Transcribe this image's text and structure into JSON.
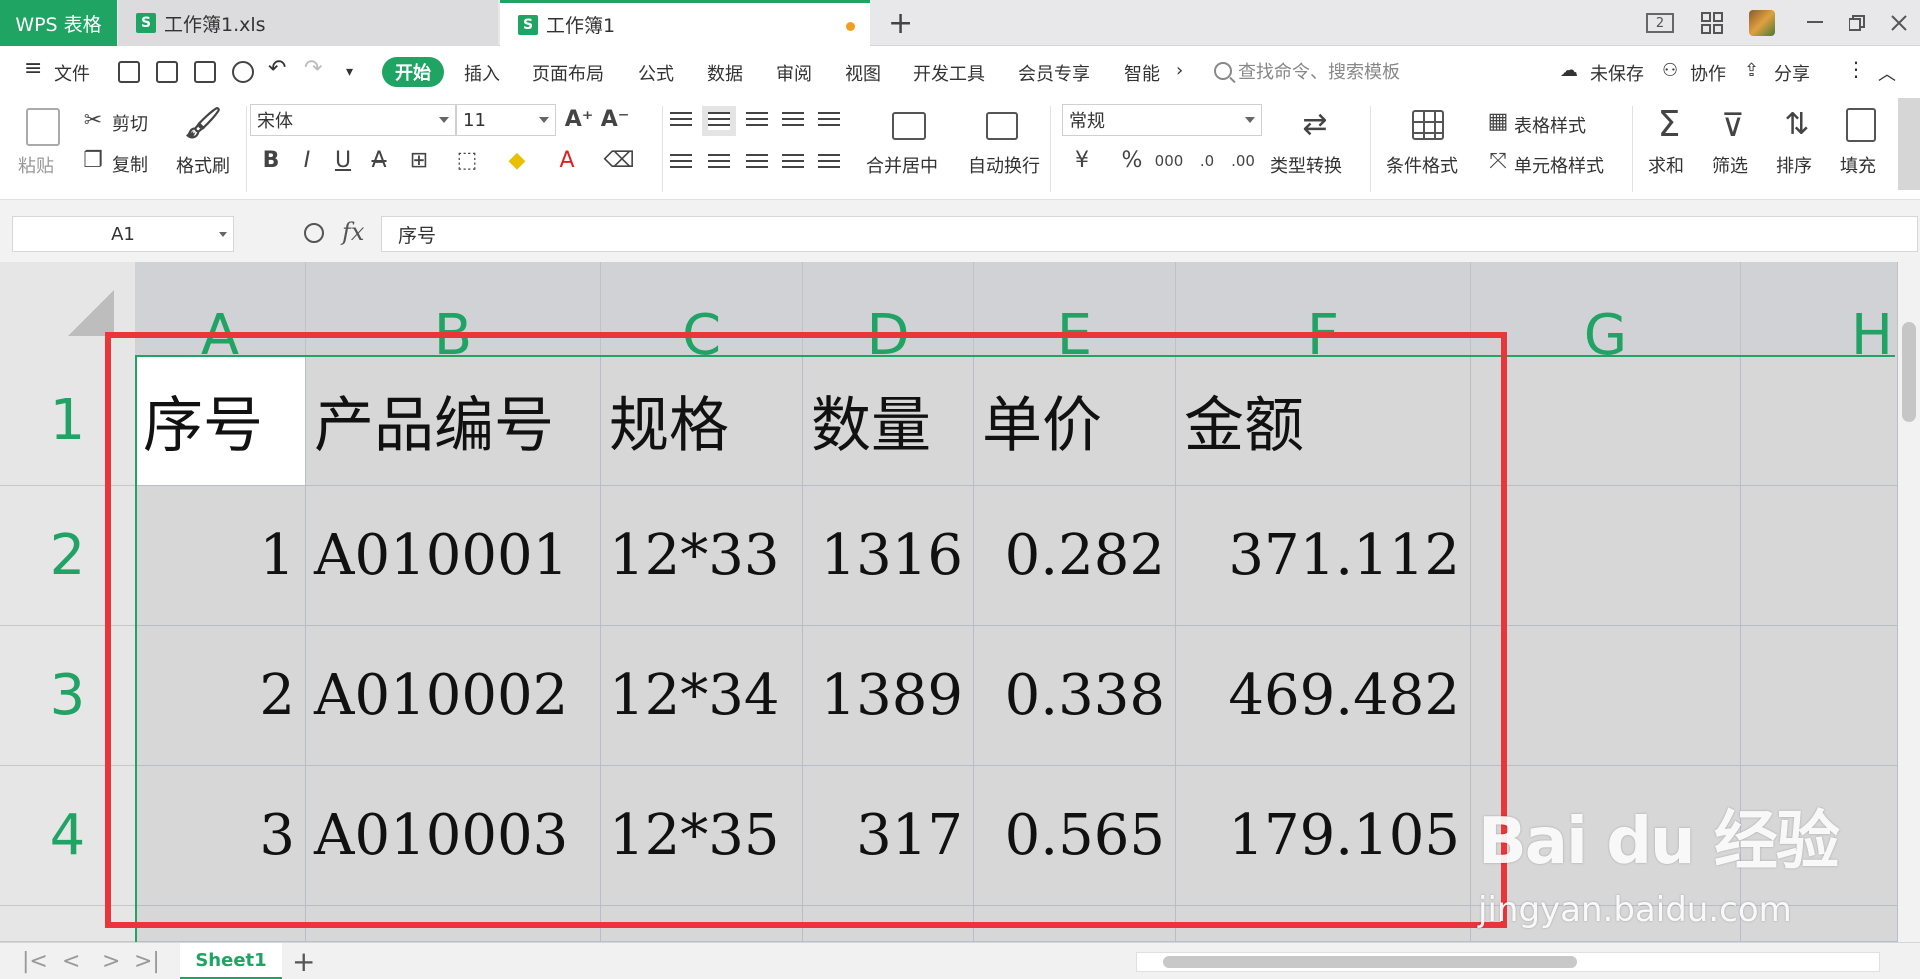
{
  "tabs": {
    "app_label": "WPS 表格",
    "doc1": "工作簿1.xls",
    "doc2": "工作簿1",
    "add": "+",
    "page_count": "2"
  },
  "menu": {
    "hamburger": "≡",
    "file": "文件",
    "items": [
      "开始",
      "插入",
      "页面布局",
      "公式",
      "数据",
      "审阅",
      "视图",
      "开发工具",
      "会员专享",
      "智能"
    ],
    "more": "›",
    "search_placeholder": "查找命令、搜索模板",
    "unsaved": "未保存",
    "collab": "协作",
    "share": "分享"
  },
  "ribbon": {
    "paste": "粘贴",
    "cut": "剪切",
    "copy": "复制",
    "format_painter": "格式刷",
    "font_name": "宋体",
    "font_size": "11",
    "merge_center": "合并居中",
    "wrap_text": "自动换行",
    "number_format": "常规",
    "convert": "类型转换",
    "cond_format": "条件格式",
    "table_style": "表格样式",
    "cell_style": "单元格样式",
    "sum": "求和",
    "filter": "筛选",
    "sort": "排序",
    "fill": "填充",
    "currency": "¥",
    "percent": "%",
    "thousand": "000",
    "inc_dec": ".0",
    "dec_dec": ".00"
  },
  "formula_bar": {
    "cell_ref": "A1",
    "fx": "fx",
    "content": "序号"
  },
  "columns": [
    "A",
    "B",
    "C",
    "D",
    "E",
    "F",
    "G",
    "H"
  ],
  "rows": [
    "1",
    "2",
    "3",
    "4"
  ],
  "table": {
    "headers": [
      "序号",
      "产品编号",
      "规格",
      "数量",
      "单价",
      "金额"
    ],
    "data": [
      [
        "1",
        "A010001",
        "12*33",
        "1316",
        "0.282",
        "371.112"
      ],
      [
        "2",
        "A010002",
        "12*34",
        "1389",
        "0.338",
        "469.482"
      ],
      [
        "3",
        "A010003",
        "12*35",
        "317",
        "0.565",
        "179.105"
      ]
    ]
  },
  "sheet": {
    "name": "Sheet1",
    "add": "+"
  },
  "watermark": {
    "logo": "Bai du 经验",
    "url": "jingyan.baidu.com"
  },
  "colors": {
    "accent": "#1fa463",
    "header_text": "#21a366",
    "highlight_box": "#e8363a",
    "selection_fill": "#d7d7d7"
  }
}
